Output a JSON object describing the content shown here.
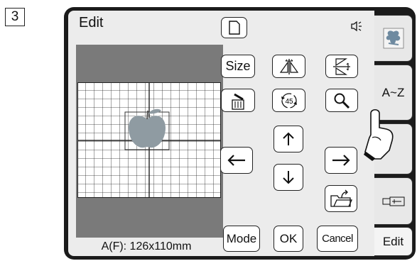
{
  "step_number": "3",
  "screen": {
    "title": "Edit",
    "size_info": "A(F): 126x110mm"
  },
  "buttons": {
    "size": "Size",
    "rotate_45": "45",
    "mode": "Mode",
    "ok": "OK",
    "cancel": "Cancel"
  },
  "tabs": {
    "letters": "A~Z",
    "edit": "Edit"
  },
  "icons": {
    "sound": "speaker-icon",
    "card": "card-icon",
    "mirror_horizontal": "mirror-horizontal-icon",
    "mirror_vertical": "mirror-vertical-icon",
    "delete": "delete-icon",
    "zoom": "magnifier-icon",
    "arrow_up": "arrow-up-icon",
    "arrow_down": "arrow-down-icon",
    "arrow_left": "arrow-left-icon",
    "arrow_right": "arrow-right-icon",
    "save": "folder-save-icon",
    "embroidery": "embroidery-pattern-icon",
    "usb": "usb-icon"
  }
}
